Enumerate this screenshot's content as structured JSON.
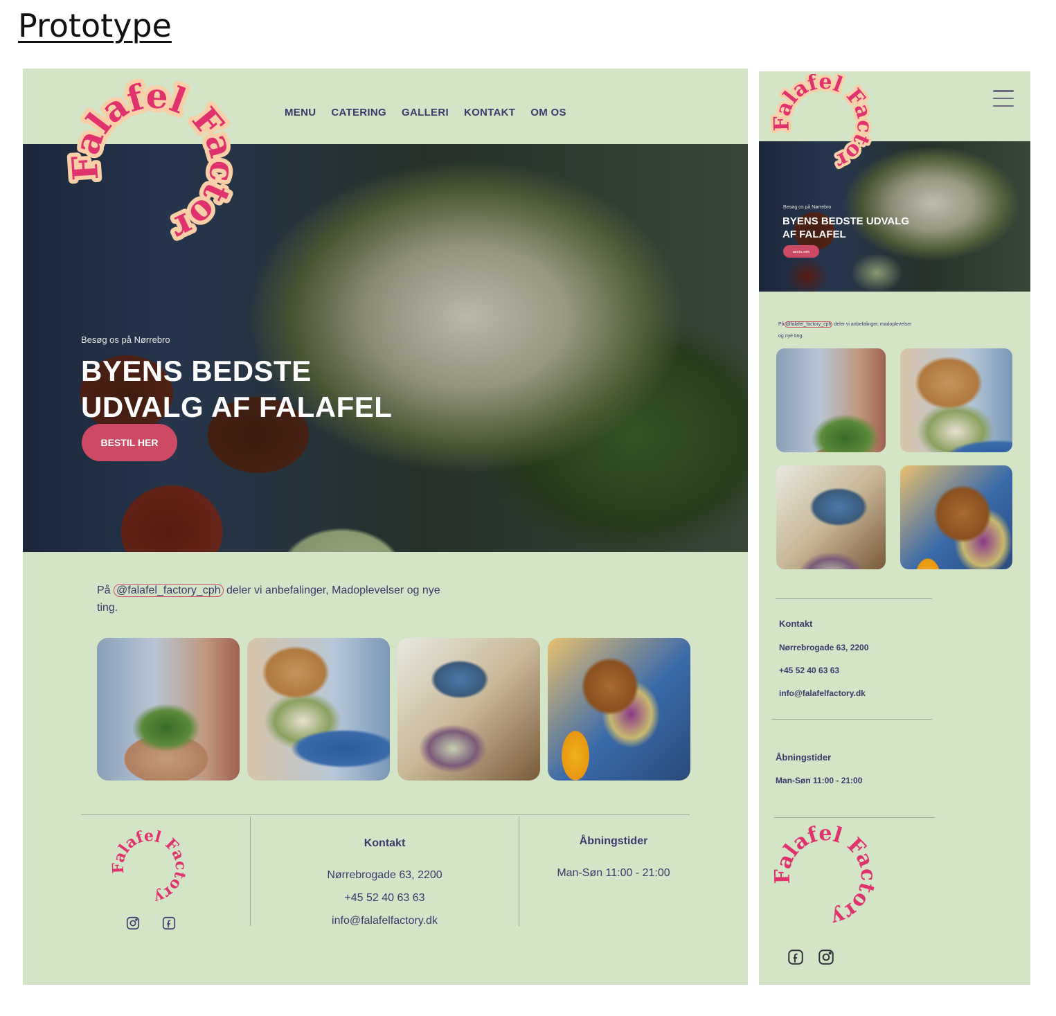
{
  "page_title": "Prototype",
  "brand": {
    "name": "Falafel Factory",
    "color": "#e0336e",
    "halo": "#f9cfa8"
  },
  "nav": [
    "MENU",
    "CATERING",
    "GALLERI",
    "KONTAKT",
    "OM OS"
  ],
  "hero": {
    "subtitle": "Besøg os på Nørrebro",
    "heading": "BYENS BEDSTE UDVALG AF FALAFEL",
    "cta": "BESTIL HER"
  },
  "instagram": {
    "prefix": "På",
    "handle": "@falafel_factory_cph",
    "desktop_suffix": "deler vi anbefalinger, Madoplevelser og nye ting.",
    "mobile_suffix": "deler vi anbefalinger, madoplevelser og nye ting."
  },
  "gallery": [
    "bowl-photo",
    "plate-photo",
    "table-photo",
    "sandwich-photo"
  ],
  "footer": {
    "kontakt_heading": "Kontakt",
    "address": "Nørrebrogade 63, 2200",
    "phone": "+45 52 40 63 63",
    "email": "info@falafelfactory.dk",
    "hours_heading": "Åbningstider",
    "hours": "Man-Søn 11:00 - 21:00"
  },
  "colors": {
    "background": "#d4e4c6",
    "text": "#3b3a6b",
    "accent": "#cc4a63"
  },
  "icons": {
    "instagram": "instagram-icon",
    "facebook": "facebook-icon",
    "menu": "hamburger-icon"
  }
}
